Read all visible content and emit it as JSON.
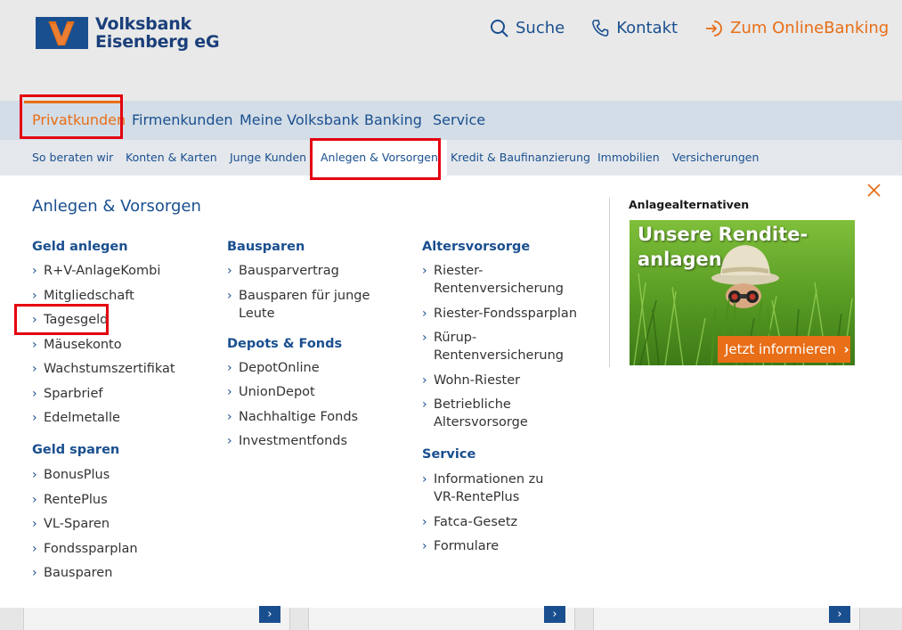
{
  "header": {
    "brand_line1": "Volksbank",
    "brand_line2": "Eisenberg eG",
    "search": "Suche",
    "contact": "Kontakt",
    "online_banking": "Zum OnlineBanking"
  },
  "main_nav": [
    "Privatkunden",
    "Firmenkunden",
    "Meine Volksbank",
    "Banking",
    "Service"
  ],
  "sub_nav": [
    "So beraten wir",
    "Konten & Karten",
    "Junge Kunden",
    "Anlegen & Vorsorgen",
    "Kredit & Baufinanzierung",
    "Immobilien",
    "Versicherungen"
  ],
  "panel": {
    "title": "Anlegen & Vorsorgen",
    "col1": {
      "group1": "Geld anlegen",
      "group1_links": [
        "R+V-AnlageKombi",
        "Mitgliedschaft",
        "Tagesgeld",
        "Mäusekonto",
        "Wachstumszertifikat",
        "Sparbrief",
        "Edelmetalle"
      ],
      "group2": "Geld sparen",
      "group2_links": [
        "BonusPlus",
        "RentePlus",
        "VL-Sparen",
        "Fondssparplan",
        "Bausparen"
      ]
    },
    "col2": {
      "group1": "Bausparen",
      "group1_links": [
        "Bausparvertrag",
        "Bausparen für junge Leute"
      ],
      "group2": "Depots & Fonds",
      "group2_links": [
        "DepotOnline",
        "UnionDepot",
        "Nachhaltige Fonds",
        "Investmentfonds"
      ]
    },
    "col3": {
      "group1": "Altersvorsorge",
      "group1_links": [
        "Riester-Rentenversicherung",
        "Riester-Fondssparplan",
        "Rürup-Rentenversicherung",
        "Wohn-Riester",
        "Betriebliche Altersvorsorge"
      ],
      "group2": "Service",
      "group2_links": [
        "Informationen zu VR-RentePlus",
        "Fatca-Gesetz",
        "Formulare"
      ]
    },
    "aside_title": "Anlagealternativen",
    "promo_line1": "Unsere Rendite-",
    "promo_line2": "anlagen",
    "promo_button": "Jetzt informieren"
  },
  "colors": {
    "primary_blue": "#1a4f8f",
    "accent_orange": "#e86e17",
    "highlight_red": "#e4000f"
  }
}
